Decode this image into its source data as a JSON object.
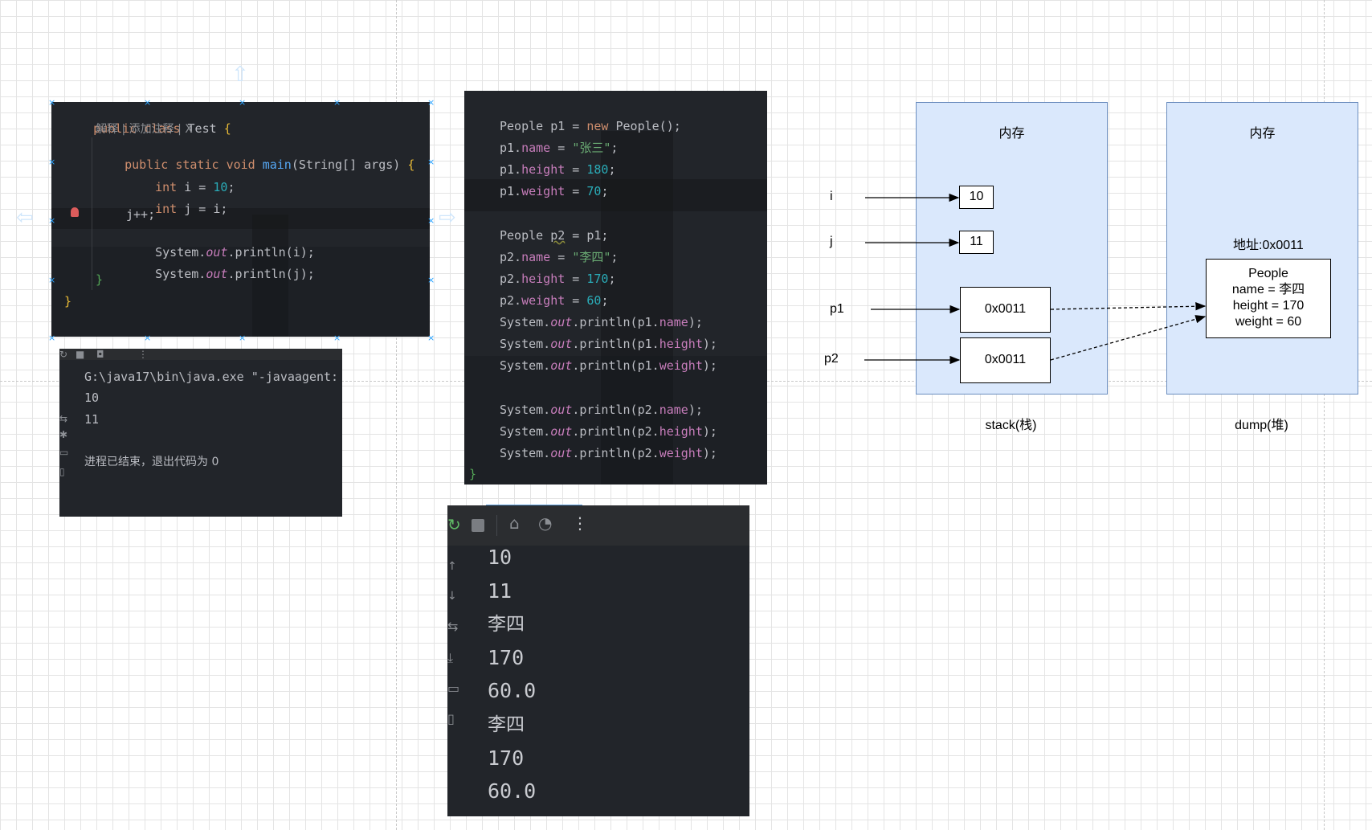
{
  "code1": {
    "line1": [
      "public",
      " ",
      "class",
      " Test ",
      "{"
    ],
    "hint": "解释 | 添加注释 | X",
    "line2": [
      "public",
      " ",
      "static",
      " ",
      "void",
      " ",
      "main",
      "(String[] args) ",
      "{"
    ],
    "line3": [
      "int",
      " i = ",
      "10",
      ";"
    ],
    "line4": [
      "int",
      " j = i;"
    ],
    "line5": "j++;",
    "line6": [
      "System.",
      "out",
      ".println(i);"
    ],
    "line7": [
      "System.",
      "out",
      ".println(j);"
    ],
    "close_inner": "}",
    "close_outer": "}"
  },
  "console1": {
    "cmd": "G:\\java17\\bin\\java.exe \"-javaagent:",
    "out1": "10",
    "out2": "11",
    "exit": "进程已结束，退出代码为 0"
  },
  "code2": {
    "l1": [
      "People p1 = ",
      "new",
      " People();"
    ],
    "l2": [
      "p1.",
      "name",
      " = ",
      "\"张三\"",
      ";"
    ],
    "l3": [
      "p1.",
      "height",
      " = ",
      "180",
      ";"
    ],
    "l4": [
      "p1.",
      "weight",
      " = ",
      "70",
      ";"
    ],
    "l5": [
      "People ",
      "p2",
      " = p1;"
    ],
    "l6": [
      "p2.",
      "name",
      " = ",
      "\"李四\"",
      ";"
    ],
    "l7": [
      "p2.",
      "height",
      " = ",
      "170",
      ";"
    ],
    "l8": [
      "p2.",
      "weight",
      " = ",
      "60",
      ";"
    ],
    "l9": [
      "System.",
      "out",
      ".println(p1.",
      "name",
      ");"
    ],
    "l10": [
      "System.",
      "out",
      ".println(p1.",
      "height",
      ");"
    ],
    "l11": [
      "System.",
      "out",
      ".println(p1.",
      "weight",
      ");"
    ],
    "l12": [
      "System.",
      "out",
      ".println(p2.",
      "name",
      ");"
    ],
    "l13": [
      "System.",
      "out",
      ".println(p2.",
      "height",
      ");"
    ],
    "l14": [
      "System.",
      "out",
      ".println(p2.",
      "weight",
      ");"
    ],
    "close": "}"
  },
  "console2": {
    "outputs": [
      "10",
      "11",
      "李四",
      "170",
      "60.0",
      "李四",
      "170",
      "60.0"
    ]
  },
  "diagram": {
    "stack": {
      "title": "内存",
      "caption": "stack(栈)",
      "vars": [
        "i",
        "j",
        "p1",
        "p2"
      ],
      "values": [
        "10",
        "11",
        "0x0011",
        "0x0011"
      ]
    },
    "heap": {
      "title": "内存",
      "caption": "dump(堆)",
      "address": "地址:0x0011",
      "object": [
        "People",
        "name = 李四",
        "height = 170",
        "weight = 60"
      ]
    }
  },
  "colors": {
    "memory_fill": "#dae8fc",
    "memory_border": "#6c8ebf",
    "code_bg": "#22252a",
    "keyword": "#cf8e6d",
    "number": "#2aacb8",
    "string": "#6aab73",
    "field": "#c77dbb",
    "method": "#56a8f5"
  }
}
